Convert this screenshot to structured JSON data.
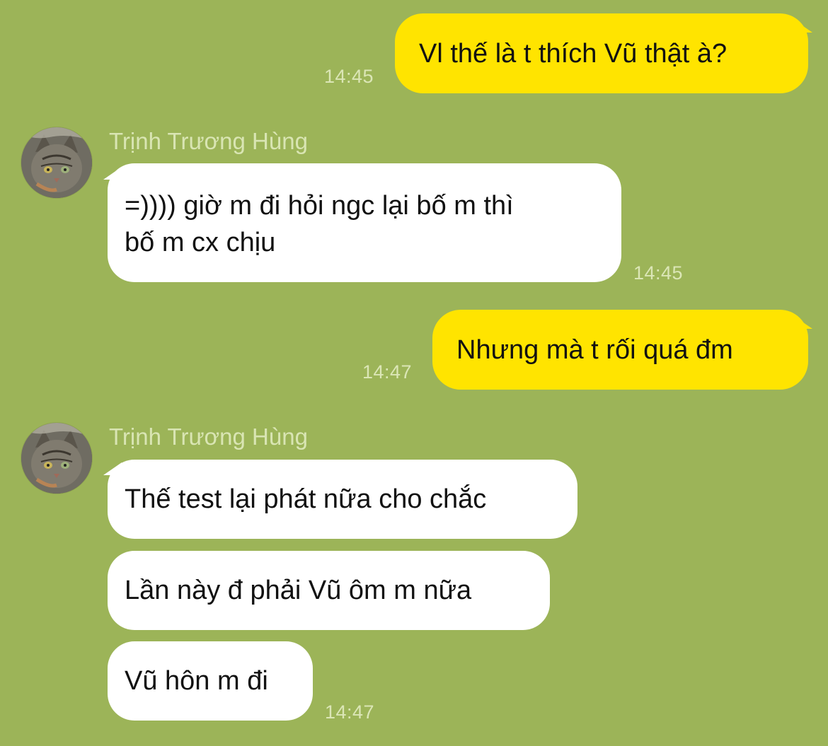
{
  "messages": [
    {
      "direction": "outgoing",
      "text": "Vl thế là t thích Vũ thật à?",
      "time": "14:45"
    },
    {
      "direction": "incoming",
      "sender": "Trịnh Trương Hùng",
      "text_line1": "=)))) giờ m đi hỏi ngc lại bố m thì",
      "text_line2": "bố m cx chịu",
      "time": "14:45"
    },
    {
      "direction": "outgoing",
      "text": "Nhưng mà t rối quá đm",
      "time": "14:47"
    },
    {
      "direction": "incoming",
      "sender": "Trịnh Trương Hùng",
      "text": "Thế test lại phát nữa cho chắc"
    },
    {
      "direction": "incoming",
      "text": "Lần này đ phải Vũ ôm m nữa"
    },
    {
      "direction": "incoming",
      "text": "Vũ hôn m đi",
      "time": "14:47"
    }
  ],
  "icons": {
    "avatar": "cat-avatar-icon"
  },
  "colors": {
    "background": "#9cb458",
    "outgoing_bubble": "#ffe400",
    "incoming_bubble": "#ffffff",
    "timestamp": "#dbe6b6",
    "sender_name": "#d9e5b3"
  }
}
